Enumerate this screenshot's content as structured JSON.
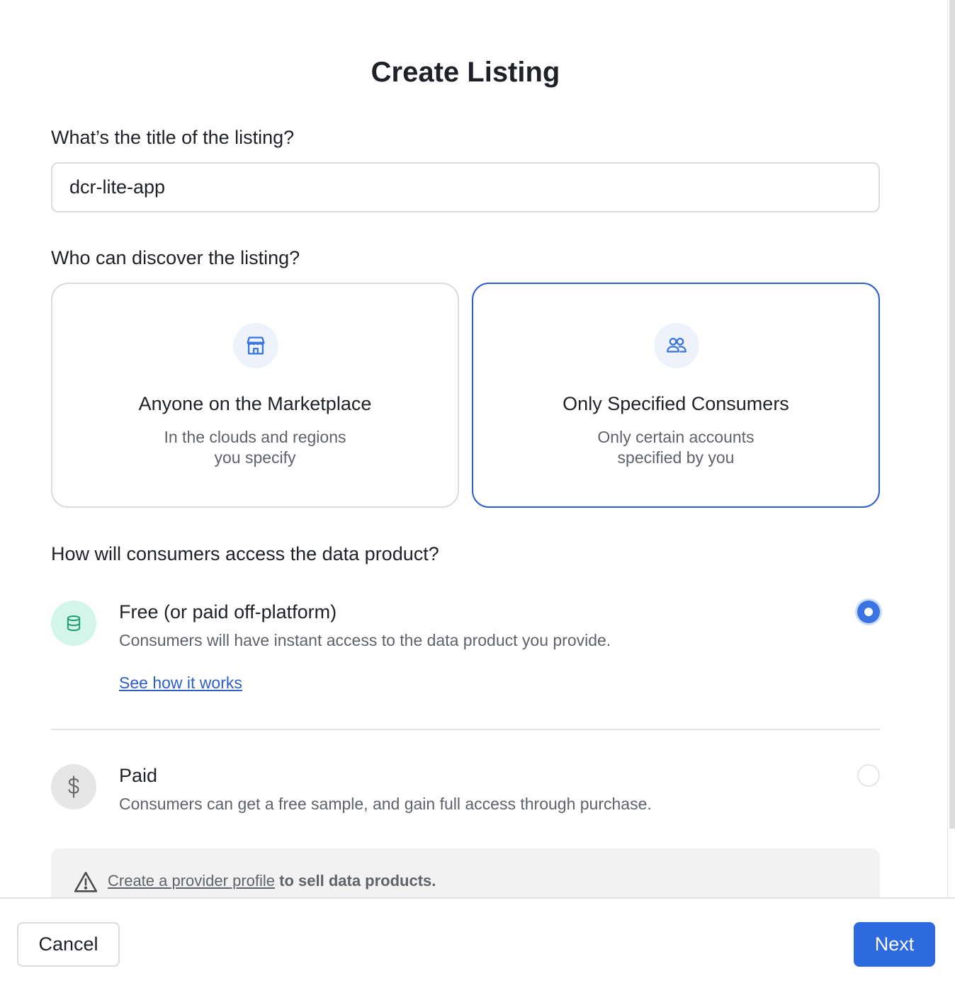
{
  "page": {
    "title": "Create Listing"
  },
  "title_section": {
    "label": "What’s the title of the listing?",
    "value": "dcr-lite-app"
  },
  "discover_section": {
    "label": "Who can discover the listing?",
    "options": [
      {
        "title": "Anyone on the Marketplace",
        "desc_line1": "In the clouds and regions",
        "desc_line2": "you specify",
        "icon": "storefront-icon",
        "selected": false
      },
      {
        "title": "Only Specified Consumers",
        "desc_line1": "Only certain accounts",
        "desc_line2": "specified by you",
        "icon": "users-icon",
        "selected": true
      }
    ]
  },
  "access_section": {
    "label": "How will consumers access the data product?",
    "options": [
      {
        "title": "Free (or paid off-platform)",
        "desc": "Consumers will have instant access to the data product you provide.",
        "link": "See how it works",
        "icon": "database-icon",
        "icon_bg": "#d4f5ea",
        "selected": true
      },
      {
        "title": "Paid",
        "desc": "Consumers can get a free sample, and gain full access through purchase.",
        "icon": "dollar-icon",
        "icon_bg": "#e6e6e6",
        "selected": false
      }
    ],
    "warning": {
      "link_text": "Create a provider profile",
      "text": " to sell data products.",
      "icon": "warning-icon"
    }
  },
  "footer": {
    "cancel_label": "Cancel",
    "next_label": "Next"
  },
  "colors": {
    "accent": "#2d6ae0",
    "selected_border": "#2d5fc7",
    "link": "#2d5fc7"
  }
}
